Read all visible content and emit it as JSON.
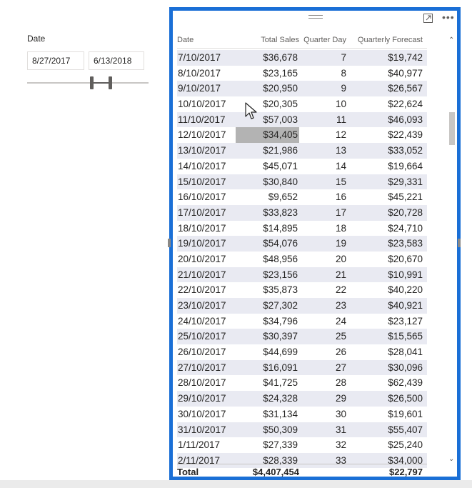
{
  "slicer": {
    "title": "Date",
    "start_date": "8/27/2017",
    "end_date": "6/13/2018"
  },
  "table": {
    "columns": [
      "Date",
      "Total Sales",
      "Quarter Day",
      "Quarterly Forecast"
    ],
    "rows": [
      [
        "7/10/2017",
        "$36,678",
        "7",
        "$19,742"
      ],
      [
        "8/10/2017",
        "$23,165",
        "8",
        "$40,977"
      ],
      [
        "9/10/2017",
        "$20,950",
        "9",
        "$26,567"
      ],
      [
        "10/10/2017",
        "$20,305",
        "10",
        "$22,624"
      ],
      [
        "11/10/2017",
        "$57,003",
        "11",
        "$46,093"
      ],
      [
        "12/10/2017",
        "$34,405",
        "12",
        "$22,439"
      ],
      [
        "13/10/2017",
        "$21,986",
        "13",
        "$33,052"
      ],
      [
        "14/10/2017",
        "$45,071",
        "14",
        "$19,664"
      ],
      [
        "15/10/2017",
        "$30,840",
        "15",
        "$29,331"
      ],
      [
        "16/10/2017",
        "$9,652",
        "16",
        "$45,221"
      ],
      [
        "17/10/2017",
        "$33,823",
        "17",
        "$20,728"
      ],
      [
        "18/10/2017",
        "$14,895",
        "18",
        "$24,710"
      ],
      [
        "19/10/2017",
        "$54,076",
        "19",
        "$23,583"
      ],
      [
        "20/10/2017",
        "$48,956",
        "20",
        "$20,670"
      ],
      [
        "21/10/2017",
        "$23,156",
        "21",
        "$10,991"
      ],
      [
        "22/10/2017",
        "$35,873",
        "22",
        "$40,220"
      ],
      [
        "23/10/2017",
        "$27,302",
        "23",
        "$40,921"
      ],
      [
        "24/10/2017",
        "$34,796",
        "24",
        "$23,127"
      ],
      [
        "25/10/2017",
        "$30,397",
        "25",
        "$15,565"
      ],
      [
        "26/10/2017",
        "$44,699",
        "26",
        "$28,041"
      ],
      [
        "27/10/2017",
        "$16,091",
        "27",
        "$30,096"
      ],
      [
        "28/10/2017",
        "$41,725",
        "28",
        "$62,439"
      ],
      [
        "29/10/2017",
        "$24,328",
        "29",
        "$26,500"
      ],
      [
        "30/10/2017",
        "$31,134",
        "30",
        "$19,601"
      ],
      [
        "31/10/2017",
        "$50,309",
        "31",
        "$55,407"
      ],
      [
        "1/11/2017",
        "$27,339",
        "32",
        "$25,240"
      ],
      [
        "2/11/2017",
        "$28,339",
        "33",
        "$34,000"
      ]
    ],
    "selected_cell": "12/10/2017",
    "total": {
      "label": "Total",
      "sales": "$4,407,454",
      "quarter_day": "",
      "forecast": "$22,797"
    }
  },
  "icons": {
    "grip": "drag-grip-icon",
    "focus": "focus-mode-icon",
    "more": "more-options-icon",
    "scroll_up": "chevron-up-icon",
    "scroll_down": "chevron-down-icon"
  },
  "colors": {
    "visual_border": "#1a6fd6",
    "row_band": "#e9eaf2",
    "selected_cell": "#b3b3b3"
  }
}
